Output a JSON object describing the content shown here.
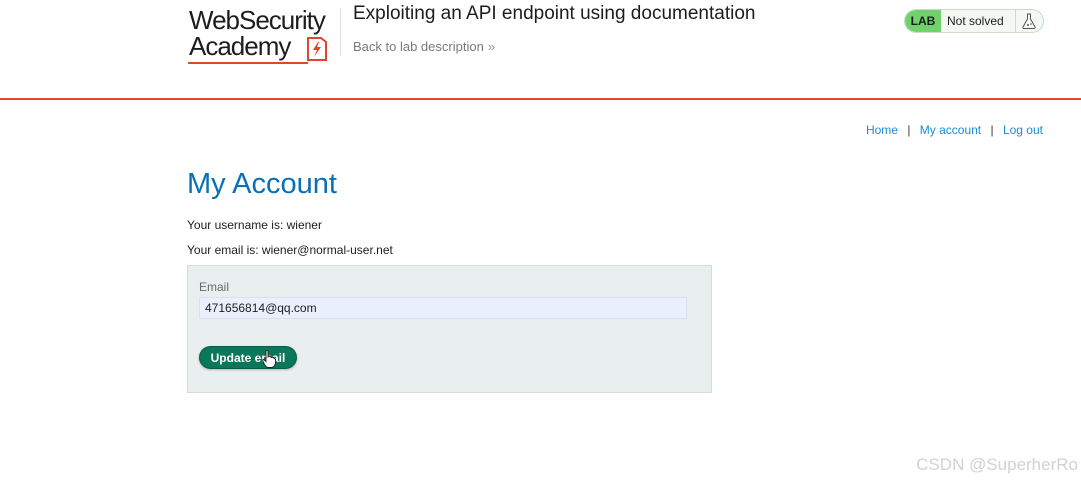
{
  "header": {
    "logo": {
      "line1": "WebSecurity",
      "line2": "Academy"
    },
    "lab_title": "Exploiting an API endpoint using documentation",
    "back_link": "Back to lab description",
    "lab_status": {
      "badge": "LAB",
      "state": "Not solved"
    }
  },
  "nav": {
    "items": [
      {
        "label": "Home"
      },
      {
        "label": "My account"
      },
      {
        "label": "Log out"
      }
    ],
    "separator": "|"
  },
  "main": {
    "title": "My Account",
    "username_line": "Your username is: wiener",
    "email_line": "Your email is: wiener@normal-user.net",
    "form": {
      "email_label": "Email",
      "email_value": "471656814@qq.com",
      "submit_label": "Update email"
    }
  },
  "watermark": "CSDN @SuperherRo",
  "colors": {
    "accent_orange": "#e2452c",
    "title_blue": "#0a6fb7",
    "link_blue": "#1f8bd0",
    "lab_green": "#70d16d",
    "button_green": "#08775a"
  },
  "icons": [
    "flask-icon",
    "chevron-double-right-icon",
    "lightning-bolt-icon",
    "pointer-cursor-icon"
  ]
}
